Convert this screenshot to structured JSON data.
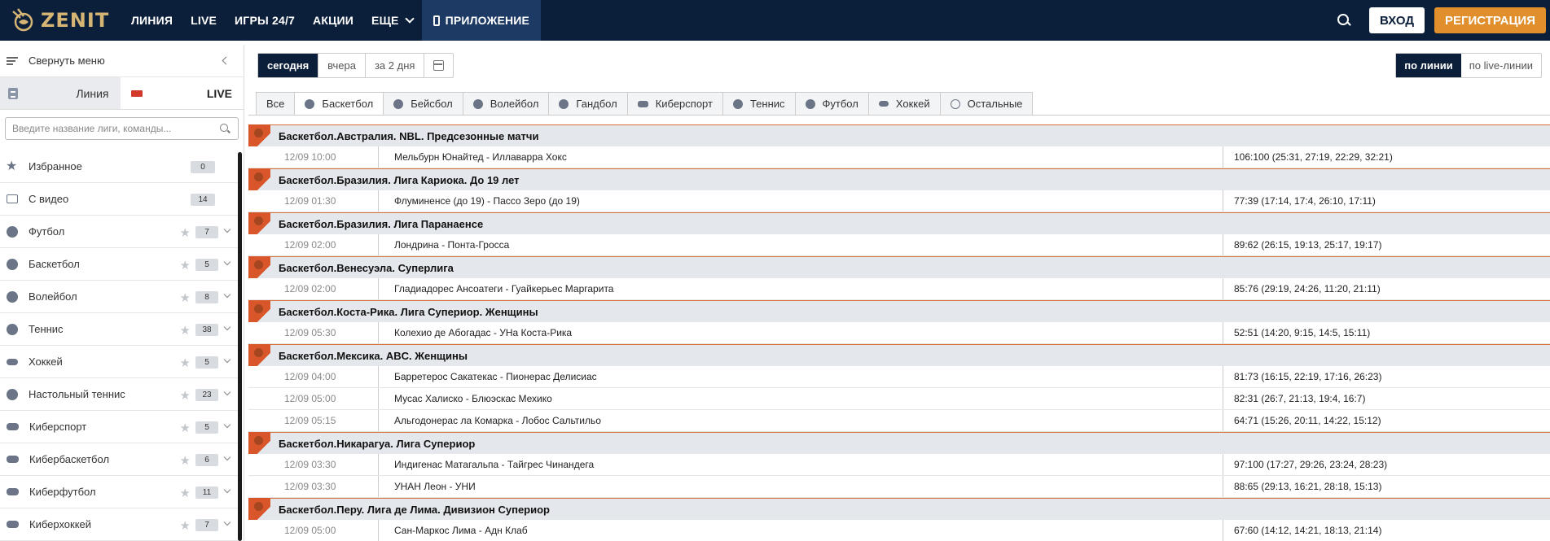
{
  "header": {
    "logo_text": "ZENIT",
    "nav": [
      {
        "label": "ЛИНИЯ"
      },
      {
        "label": "LIVE"
      },
      {
        "label": "ИГРЫ 24/7"
      },
      {
        "label": "АКЦИИ"
      },
      {
        "label": "ЕЩЕ"
      },
      {
        "label": "ПРИЛОЖЕНИЕ"
      }
    ],
    "login_label": "ВХОД",
    "register_label": "РЕГИСТРАЦИЯ",
    "accent_color": "#e08f2c",
    "bg_color": "#0c1f3a"
  },
  "sidebar": {
    "collapse_label": "Свернуть меню",
    "mode_tabs": {
      "line": "Линия",
      "live": "LIVE"
    },
    "search_placeholder": "Введите название лиги, команды...",
    "items": [
      {
        "name": "Избранное",
        "count": "0",
        "icon": "star-icon"
      },
      {
        "name": "С видео",
        "count": "14",
        "icon": "video-icon"
      },
      {
        "name": "Футбол",
        "count": "7",
        "icon": "football-icon"
      },
      {
        "name": "Баскетбол",
        "count": "5",
        "icon": "basketball-icon"
      },
      {
        "name": "Волейбол",
        "count": "8",
        "icon": "volleyball-icon"
      },
      {
        "name": "Теннис",
        "count": "38",
        "icon": "tennis-icon"
      },
      {
        "name": "Хоккей",
        "count": "5",
        "icon": "hockey-icon"
      },
      {
        "name": "Настольный теннис",
        "count": "23",
        "icon": "table-tennis-icon"
      },
      {
        "name": "Киберспорт",
        "count": "5",
        "icon": "gamepad-icon"
      },
      {
        "name": "Кибербаскетбол",
        "count": "6",
        "icon": "gamepad-icon"
      },
      {
        "name": "Киберфутбол",
        "count": "11",
        "icon": "gamepad-icon"
      },
      {
        "name": "Киберхоккей",
        "count": "7",
        "icon": "gamepad-icon"
      }
    ]
  },
  "filters": {
    "date_tabs": [
      "сегодня",
      "вчера",
      "за 2 дня"
    ],
    "mode": [
      "по линии",
      "по live-линии"
    ],
    "sport_tabs": [
      {
        "label": "Все",
        "icon": ""
      },
      {
        "label": "Баскетбол",
        "icon": "basketball-icon"
      },
      {
        "label": "Бейсбол",
        "icon": "baseball-icon"
      },
      {
        "label": "Волейбол",
        "icon": "volleyball-icon"
      },
      {
        "label": "Гандбол",
        "icon": "handball-icon"
      },
      {
        "label": "Киберспорт",
        "icon": "gamepad-icon"
      },
      {
        "label": "Теннис",
        "icon": "tennis-icon"
      },
      {
        "label": "Футбол",
        "icon": "football-icon"
      },
      {
        "label": "Хоккей",
        "icon": "hockey-icon"
      },
      {
        "label": "Остальные",
        "icon": "other-icon"
      }
    ]
  },
  "leagues": [
    {
      "name": "Баскетбол.Австралия. NBL. Предсезонные матчи",
      "events": [
        {
          "time": "12/09 10:00",
          "teams": "Мельбурн Юнайтед - Иллаварра Хокс",
          "score": "106:100 (25:31, 27:19, 22:29, 32:21)"
        }
      ]
    },
    {
      "name": "Баскетбол.Бразилия. Лига Кариока. До 19 лет",
      "events": [
        {
          "time": "12/09 01:30",
          "teams": "Флуминенсе (до 19) - Пассо Зеро (до 19)",
          "score": "77:39 (17:14, 17:4, 26:10, 17:11)"
        }
      ]
    },
    {
      "name": "Баскетбол.Бразилия. Лига Паранаенсе",
      "events": [
        {
          "time": "12/09 02:00",
          "teams": "Лондрина - Понта-Гросса",
          "score": "89:62 (26:15, 19:13, 25:17, 19:17)"
        }
      ]
    },
    {
      "name": "Баскетбол.Венесуэла. Суперлига",
      "events": [
        {
          "time": "12/09 02:00",
          "teams": "Гладиадорес Ансоатеги - Гуайкерьес Маргарита",
          "score": "85:76 (29:19, 24:26, 11:20, 21:11)"
        }
      ]
    },
    {
      "name": "Баскетбол.Коста-Рика. Лига Супериор. Женщины",
      "events": [
        {
          "time": "12/09 05:30",
          "teams": "Колехио де Абогадас - УНа Коста-Рика",
          "score": "52:51 (14:20, 9:15, 14:5, 15:11)"
        }
      ]
    },
    {
      "name": "Баскетбол.Мексика. ABC. Женщины",
      "events": [
        {
          "time": "12/09 04:00",
          "teams": "Барретерос Сакатекас - Пионерас Делисиас",
          "score": "81:73 (16:15, 22:19, 17:16, 26:23)"
        },
        {
          "time": "12/09 05:00",
          "teams": "Мусас Халиско - Блюэскас Мехико",
          "score": "82:31 (26:7, 21:13, 19:4, 16:7)"
        },
        {
          "time": "12/09 05:15",
          "teams": "Альгодонерас ла Комарка - Лобос Сальтильо",
          "score": "64:71 (15:26, 20:11, 14:22, 15:12)"
        }
      ]
    },
    {
      "name": "Баскетбол.Никарагуа. Лига Супериор",
      "events": [
        {
          "time": "12/09 03:30",
          "teams": "Индигенас Матагальпа - Тайгрес Чинандега",
          "score": "97:100 (17:27, 29:26, 23:24, 28:23)"
        },
        {
          "time": "12/09 03:30",
          "teams": "УНАН Леон - УНИ",
          "score": "88:65 (29:13, 16:21, 28:18, 15:13)"
        }
      ]
    },
    {
      "name": "Баскетбол.Перу. Лига де Лима. Дивизион Супериор",
      "events": [
        {
          "time": "12/09 05:00",
          "teams": "Сан-Маркос Лима - Адн Клаб",
          "score": "67:60 (14:12, 14:21, 18:13, 21:14)"
        }
      ]
    }
  ]
}
